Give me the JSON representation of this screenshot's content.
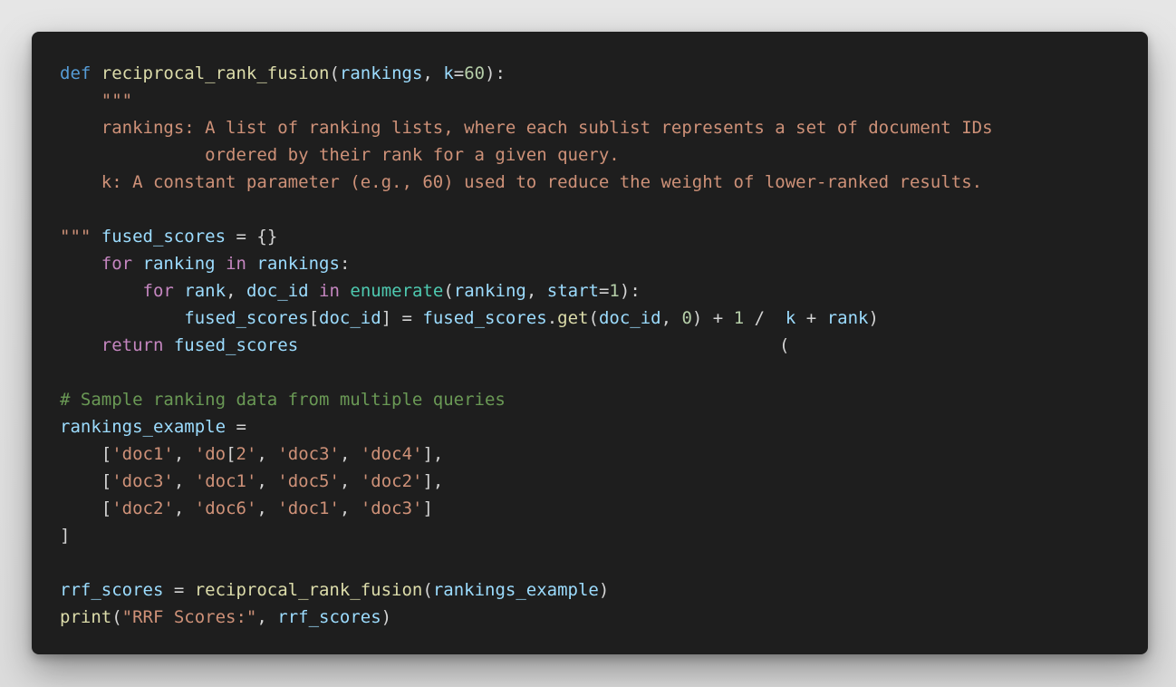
{
  "editor": {
    "theme_background": "#1e1e1e",
    "colors": {
      "keyword": "#569cd6",
      "control": "#c586c0",
      "function": "#dcdcaa",
      "variable": "#9cdcfe",
      "string": "#ce9178",
      "number": "#b5cea8",
      "comment": "#6a9955",
      "builtin": "#4ec9b0"
    },
    "code": {
      "l1": {
        "def": "def",
        "name": "reciprocal_rank_fusion",
        "p1": "(",
        "arg1": "rankings",
        "p2": ", ",
        "arg2": "k",
        "eq": "=",
        "num": "60",
        "p3": "):"
      },
      "l2": "    \"\"\"",
      "l3": "    rankings: A list of ranking lists, where each sublist represents a set of document IDs",
      "l4": "              ordered by their rank for a given query.",
      "l5": "    k: A constant parameter (e.g., 60) used to reduce the weight of lower-ranked results.",
      "l6": "",
      "l7": {
        "doc_end": "\"\"\"",
        "sp": " ",
        "var": "fused_scores",
        "rest": " = {}"
      },
      "l8": {
        "indent": "    ",
        "for": "for",
        "sp1": " ",
        "v1": "ranking",
        "sp2": " ",
        "in": "in",
        "sp3": " ",
        "v2": "rankings",
        "colon": ":"
      },
      "l9": {
        "indent": "        ",
        "for": "for",
        "sp1": " ",
        "v1": "rank",
        "c1": ", ",
        "v2": "doc_id",
        "sp2": " ",
        "in": "in",
        "sp3": " ",
        "fn": "enumerate",
        "p1": "(",
        "v3": "ranking",
        "c2": ", ",
        "v4": "start",
        "eq": "=",
        "num": "1",
        "p2": "):"
      },
      "l10": {
        "indent": "            ",
        "v1": "fused_scores",
        "b1": "[",
        "v2": "doc_id",
        "b2": "] = ",
        "v3": "fused_scores",
        "dot": ".",
        "fn": "get",
        "p1": "(",
        "v4": "doc_id",
        "c1": ", ",
        "num0": "0",
        "p2": ") + ",
        "num1": "1",
        "div": " /  ",
        "v5": "k",
        "plus": " + ",
        "v6": "rank",
        "p3": ")"
      },
      "l11": {
        "indent": "    ",
        "ret": "return",
        "sp": " ",
        "v": "fused_scores",
        "stray_paren": "("
      },
      "l12": "",
      "l13": "# Sample ranking data from multiple queries",
      "l14": {
        "v": "rankings_example",
        "rest": " ="
      },
      "l15": {
        "indent": "    ",
        "open": "[",
        "s1": "'doc1'",
        "c1": ", ",
        "s2a": "'do",
        "bracket": "[",
        "s2b": "2'",
        "c2": ", ",
        "s3": "'doc3'",
        "c3": ", ",
        "s4": "'doc4'",
        "close": "],"
      },
      "l16": {
        "indent": "    ",
        "open": "[",
        "s1": "'doc3'",
        "c1": ", ",
        "s2": "'doc1'",
        "c2": ", ",
        "s3": "'doc5'",
        "c3": ", ",
        "s4": "'doc2'",
        "close": "],"
      },
      "l17": {
        "indent": "    ",
        "open": "[",
        "s1": "'doc2'",
        "c1": ", ",
        "s2": "'doc6'",
        "c2": ", ",
        "s3": "'doc1'",
        "c3": ", ",
        "s4": "'doc3'",
        "close": "]"
      },
      "l18": "]",
      "l19": "",
      "l20": {
        "v1": "rrf_scores",
        "eq": " = ",
        "fn": "reciprocal_rank_fusion",
        "p1": "(",
        "v2": "rankings_example",
        "p2": ")"
      },
      "l21": {
        "fn": "print",
        "p1": "(",
        "s": "\"RRF Scores:\"",
        "c": ", ",
        "v": "rrf_scores",
        "p2": ")"
      }
    }
  }
}
